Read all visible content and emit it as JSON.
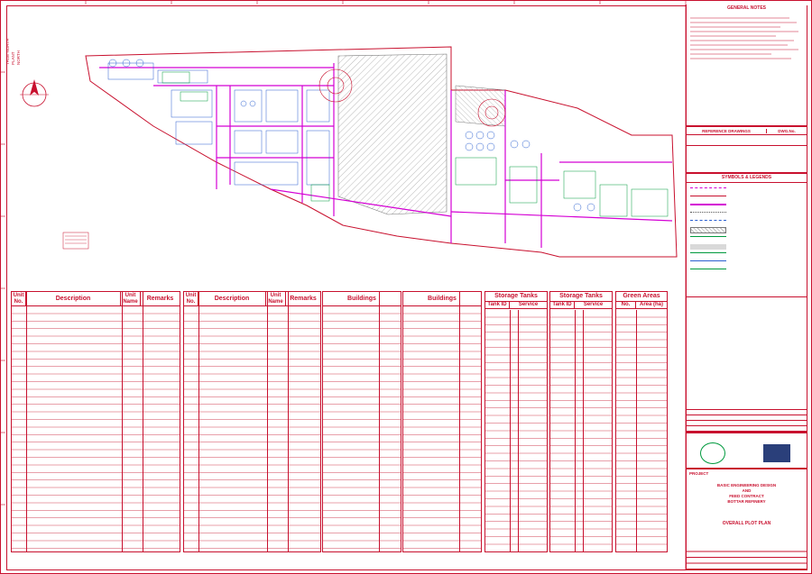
{
  "title_block": {
    "general_notes_title": "GENERAL NOTES",
    "reference_title": "REFERENCE DRAWINGS",
    "dwg_no_label": "DWG.No.",
    "symbols_title": "SYMBOLS & LEGENDS",
    "project_label": "PROJECT",
    "project_line1": "BASIC ENGINEERING DESIGN",
    "project_line2": "AND",
    "project_line3": "FEED CONTRACT",
    "project_line4": "BOTTAR REFINERY",
    "plan_title": "OVERALL PLOT PLAN"
  },
  "north": {
    "label1": "TRUE NORTH",
    "label2": "PLANT NORTH"
  },
  "tables": {
    "units_a": {
      "title": "Unit No.",
      "desc": "Description",
      "name": "Unit Name",
      "remarks": "Remarks"
    },
    "units_b": {
      "title": "Unit No.",
      "desc": "Description",
      "name": "Unit Name",
      "remarks": "Remarks"
    },
    "buildings_a": {
      "title": "Buildings"
    },
    "buildings_b": {
      "title": "Buildings"
    },
    "storage_a": {
      "title": "Storage Tanks",
      "c1": "Tank ID",
      "c2": "Service"
    },
    "storage_b": {
      "title": "Storage Tanks",
      "c1": "Tank ID",
      "c2": "Service"
    },
    "green": {
      "title": "Green Areas",
      "c1": "No.",
      "c2": "Area (ha)"
    }
  },
  "colors": {
    "border": "#c8102e",
    "plan_magenta": "#d400d4",
    "plan_green": "#009a3e",
    "plan_blue": "#2a5fd0",
    "hatch": "#9a9a9a"
  }
}
